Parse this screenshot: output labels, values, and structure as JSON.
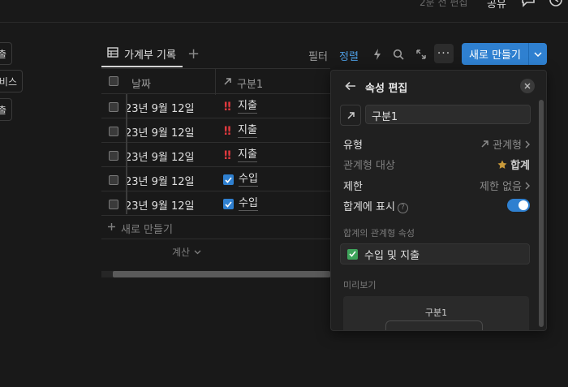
{
  "topbar": {
    "edited": "2분 전 편집",
    "share": "공유"
  },
  "left_buttons": [
    "출",
    "비스",
    "출"
  ],
  "tabs": {
    "active_label": "가계부 기록",
    "add": "+"
  },
  "toolbar": {
    "filter": "필터",
    "sort": "정렬",
    "more": "···",
    "new_label": "새로 만들기"
  },
  "table": {
    "columns": {
      "date": "날짜",
      "category": "구분1"
    },
    "rows": [
      {
        "date": "23년 9월 12일",
        "category": "지출",
        "kind": "expense"
      },
      {
        "date": "23년 9월 12일",
        "category": "지출",
        "kind": "expense"
      },
      {
        "date": "23년 9월 12일",
        "category": "지출",
        "kind": "expense"
      },
      {
        "date": "23년 9월 12일",
        "category": "수입",
        "kind": "income"
      },
      {
        "date": "23년 9월 12일",
        "category": "수입",
        "kind": "income"
      }
    ],
    "new_row": "새로 만들기",
    "calc": "계산"
  },
  "panel": {
    "title": "속성 편집",
    "name_value": "구분1",
    "type_label": "유형",
    "type_value": "관계형",
    "target_label": "관계형 대상",
    "target_value": "합계",
    "limit_label": "제한",
    "limit_value": "제한 없음",
    "show_label": "합계에 표시",
    "related_section": "합계의 관계형 속성",
    "related_prop": "수입 및 지출",
    "preview_section": "미리보기",
    "preview_label": "구분1"
  },
  "colors": {
    "accent": "#2f80d0",
    "danger": "#e0393e",
    "star": "#c99a3a"
  }
}
